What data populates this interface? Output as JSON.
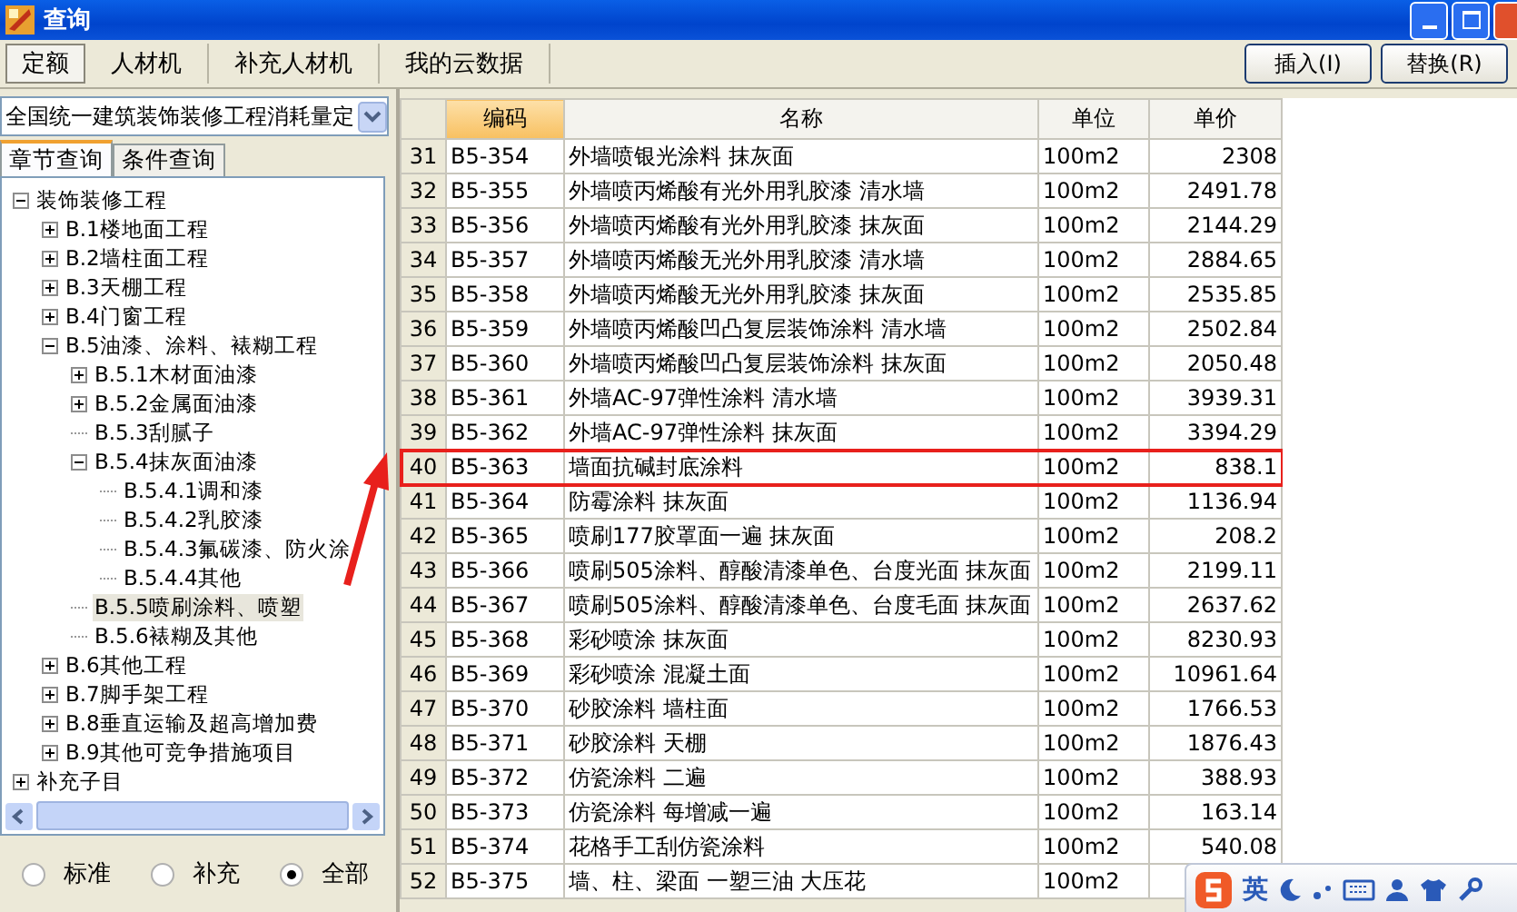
{
  "window": {
    "title": "查询"
  },
  "tabs": [
    {
      "label": "定额",
      "selected": true
    },
    {
      "label": "人材机",
      "selected": false
    },
    {
      "label": "补充人材机",
      "selected": false
    },
    {
      "label": "我的云数据",
      "selected": false
    }
  ],
  "buttons": [
    "插入(I)",
    "替换(R)"
  ],
  "library_select": {
    "value": "全国统一建筑装饰装修工程消耗量定"
  },
  "subtabs": [
    {
      "label": "章节查询",
      "selected": true
    },
    {
      "label": "条件查询",
      "selected": false
    }
  ],
  "tree": [
    {
      "label": "装饰装修工程",
      "expanded": true,
      "selected": false,
      "children": [
        {
          "label": "B.1楼地面工程",
          "expanded": false,
          "selected": false
        },
        {
          "label": "B.2墙柱面工程",
          "expanded": false,
          "selected": false
        },
        {
          "label": "B.3天棚工程",
          "expanded": false,
          "selected": false
        },
        {
          "label": "B.4门窗工程",
          "expanded": false,
          "selected": false
        },
        {
          "label": "B.5油漆、涂料、裱糊工程",
          "expanded": true,
          "selected": false,
          "children": [
            {
              "label": "B.5.1木材面油漆",
              "expanded": false,
              "selected": false
            },
            {
              "label": "B.5.2金属面油漆",
              "expanded": false,
              "selected": false
            },
            {
              "label": "B.5.3刮腻子",
              "selected": false
            },
            {
              "label": "B.5.4抹灰面油漆",
              "expanded": true,
              "selected": false,
              "children": [
                {
                  "label": "B.5.4.1调和漆",
                  "selected": false
                },
                {
                  "label": "B.5.4.2乳胶漆",
                  "selected": false
                },
                {
                  "label": "B.5.4.3氟碳漆、防火涂",
                  "selected": false
                },
                {
                  "label": "B.5.4.4其他",
                  "selected": false
                }
              ]
            },
            {
              "label": "B.5.5喷刷涂料、喷塑",
              "selected": true
            },
            {
              "label": "B.5.6裱糊及其他",
              "selected": false
            }
          ]
        },
        {
          "label": "B.6其他工程",
          "expanded": false,
          "selected": false
        },
        {
          "label": "B.7脚手架工程",
          "expanded": false,
          "selected": false
        },
        {
          "label": "B.8垂直运输及超高增加费",
          "expanded": false,
          "selected": false
        },
        {
          "label": "B.9其他可竞争措施项目",
          "expanded": false,
          "selected": false
        }
      ]
    },
    {
      "label": "补充子目",
      "expanded": false,
      "selected": false
    }
  ],
  "filter": [
    {
      "label": "标准",
      "selected": false
    },
    {
      "label": "补充",
      "selected": false
    },
    {
      "label": "全部",
      "selected": true
    }
  ],
  "table": {
    "columns": [
      {
        "label": "编码",
        "sorted": true
      },
      {
        "label": "名称",
        "sorted": false
      },
      {
        "label": "单位",
        "sorted": false
      },
      {
        "label": "单价",
        "sorted": false
      }
    ],
    "rows": [
      {
        "index": "31",
        "code": "B5-354",
        "name": "外墙喷银光涂料 抹灰面",
        "unit": "100m2",
        "price": "2308",
        "highlighted": false
      },
      {
        "index": "32",
        "code": "B5-355",
        "name": "外墙喷丙烯酸有光外用乳胶漆 清水墙",
        "unit": "100m2",
        "price": "2491.78",
        "highlighted": false
      },
      {
        "index": "33",
        "code": "B5-356",
        "name": "外墙喷丙烯酸有光外用乳胶漆 抹灰面",
        "unit": "100m2",
        "price": "2144.29",
        "highlighted": false
      },
      {
        "index": "34",
        "code": "B5-357",
        "name": "外墙喷丙烯酸无光外用乳胶漆 清水墙",
        "unit": "100m2",
        "price": "2884.65",
        "highlighted": false
      },
      {
        "index": "35",
        "code": "B5-358",
        "name": "外墙喷丙烯酸无光外用乳胶漆 抹灰面",
        "unit": "100m2",
        "price": "2535.85",
        "highlighted": false
      },
      {
        "index": "36",
        "code": "B5-359",
        "name": "外墙喷丙烯酸凹凸复层装饰涂料 清水墙",
        "unit": "100m2",
        "price": "2502.84",
        "highlighted": false
      },
      {
        "index": "37",
        "code": "B5-360",
        "name": "外墙喷丙烯酸凹凸复层装饰涂料 抹灰面",
        "unit": "100m2",
        "price": "2050.48",
        "highlighted": false
      },
      {
        "index": "38",
        "code": "B5-361",
        "name": "外墙AC-97弹性涂料 清水墙",
        "unit": "100m2",
        "price": "3939.31",
        "highlighted": false
      },
      {
        "index": "39",
        "code": "B5-362",
        "name": "外墙AC-97弹性涂料 抹灰面",
        "unit": "100m2",
        "price": "3394.29",
        "highlighted": false
      },
      {
        "index": "40",
        "code": "B5-363",
        "name": "墙面抗碱封底涂料",
        "unit": "100m2",
        "price": "838.1",
        "highlighted": true
      },
      {
        "index": "41",
        "code": "B5-364",
        "name": "防霉涂料 抹灰面",
        "unit": "100m2",
        "price": "1136.94",
        "highlighted": false
      },
      {
        "index": "42",
        "code": "B5-365",
        "name": "喷刷177胶罩面一遍 抹灰面",
        "unit": "100m2",
        "price": "208.2",
        "highlighted": false
      },
      {
        "index": "43",
        "code": "B5-366",
        "name": "喷刷505涂料、醇酸清漆单色、台度光面 抹灰面",
        "unit": "100m2",
        "price": "2199.11",
        "highlighted": false
      },
      {
        "index": "44",
        "code": "B5-367",
        "name": "喷刷505涂料、醇酸清漆单色、台度毛面 抹灰面",
        "unit": "100m2",
        "price": "2637.62",
        "highlighted": false
      },
      {
        "index": "45",
        "code": "B5-368",
        "name": "彩砂喷涂 抹灰面",
        "unit": "100m2",
        "price": "8230.93",
        "highlighted": false
      },
      {
        "index": "46",
        "code": "B5-369",
        "name": "彩砂喷涂 混凝土面",
        "unit": "100m2",
        "price": "10961.64",
        "highlighted": false
      },
      {
        "index": "47",
        "code": "B5-370",
        "name": "砂胶涂料 墙柱面",
        "unit": "100m2",
        "price": "1766.53",
        "highlighted": false
      },
      {
        "index": "48",
        "code": "B5-371",
        "name": "砂胶涂料 天棚",
        "unit": "100m2",
        "price": "1876.43",
        "highlighted": false
      },
      {
        "index": "49",
        "code": "B5-372",
        "name": "仿瓷涂料 二遍",
        "unit": "100m2",
        "price": "388.93",
        "highlighted": false
      },
      {
        "index": "50",
        "code": "B5-373",
        "name": "仿瓷涂料 每增减一遍",
        "unit": "100m2",
        "price": "163.14",
        "highlighted": false
      },
      {
        "index": "51",
        "code": "B5-374",
        "name": "花格手工刮仿瓷涂料",
        "unit": "100m2",
        "price": "540.08",
        "highlighted": false
      },
      {
        "index": "52",
        "code": "B5-375",
        "name": "墙、柱、梁面 一塑三油 大压花",
        "unit": "100m2",
        "highlighted": false
      }
    ]
  },
  "ime_toolbar": {
    "mode": "英"
  }
}
